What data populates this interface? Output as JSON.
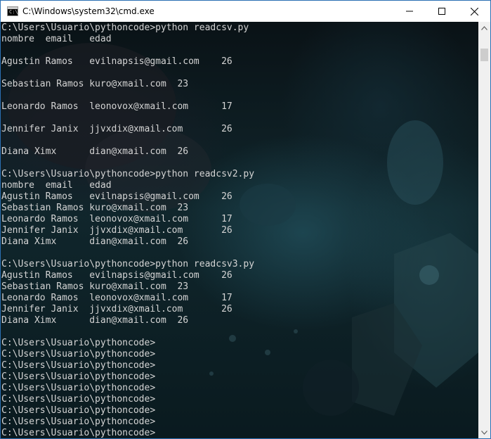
{
  "window": {
    "title": "C:\\Windows\\system32\\cmd.exe",
    "icon": "cmd-icon",
    "icon_text": "C:\\",
    "controls": [
      "minimize-icon",
      "maximize-icon",
      "close-icon"
    ]
  },
  "console": {
    "lines": [
      "C:\\Users\\Usuario\\pythoncode>python readcsv.py",
      "nombre  email   edad",
      "",
      "Agustin Ramos   evilnapsis@gmail.com    26",
      "",
      "Sebastian Ramos kuro@xmail.com  23",
      "",
      "Leonardo Ramos  leonovox@xmail.com      17",
      "",
      "Jennifer Janix  jjvxdix@xmail.com       26",
      "",
      "Diana Ximx      dian@xmail.com  26",
      "",
      "C:\\Users\\Usuario\\pythoncode>python readcsv2.py",
      "nombre  email   edad",
      "Agustin Ramos   evilnapsis@gmail.com    26",
      "Sebastian Ramos kuro@xmail.com  23",
      "Leonardo Ramos  leonovox@xmail.com      17",
      "Jennifer Janix  jjvxdix@xmail.com       26",
      "Diana Ximx      dian@xmail.com  26",
      "",
      "C:\\Users\\Usuario\\pythoncode>python readcsv3.py",
      "Agustin Ramos   evilnapsis@gmail.com    26",
      "Sebastian Ramos kuro@xmail.com  23",
      "Leonardo Ramos  leonovox@xmail.com      17",
      "Jennifer Janix  jjvxdix@xmail.com       26",
      "Diana Ximx      dian@xmail.com  26",
      "",
      "C:\\Users\\Usuario\\pythoncode>",
      "C:\\Users\\Usuario\\pythoncode>",
      "C:\\Users\\Usuario\\pythoncode>",
      "C:\\Users\\Usuario\\pythoncode>",
      "C:\\Users\\Usuario\\pythoncode>",
      "C:\\Users\\Usuario\\pythoncode>",
      "C:\\Users\\Usuario\\pythoncode>",
      "C:\\Users\\Usuario\\pythoncode>",
      "C:\\Users\\Usuario\\pythoncode>"
    ],
    "text_color": "#d4d4d4"
  },
  "scrollbar": {
    "up_icon": "scroll-up-arrow-icon",
    "down_icon": "scroll-down-arrow-icon"
  },
  "colors": {
    "titlebar_bg": "#ffffff",
    "border": "#2a6fb3",
    "scrollbar_bg": "#f0f0f0",
    "scrollbar_thumb": "#cdcdcd"
  }
}
